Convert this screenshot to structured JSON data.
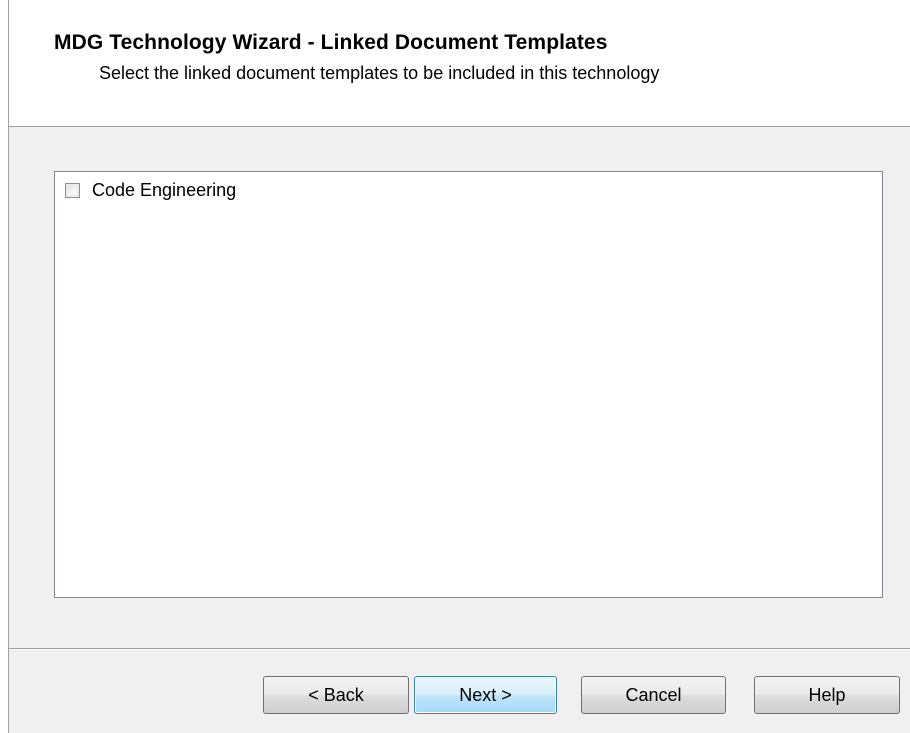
{
  "wizard": {
    "title": "MDG Technology Wizard - Linked Document Templates",
    "subtitle": "Select the linked document templates to be included in this technology"
  },
  "templates_list": {
    "items": [
      {
        "label": "Code Engineering",
        "checked": false
      }
    ]
  },
  "buttons": {
    "back_label": "< Back",
    "next_label": "Next >",
    "cancel_label": "Cancel",
    "help_label": "Help"
  }
}
